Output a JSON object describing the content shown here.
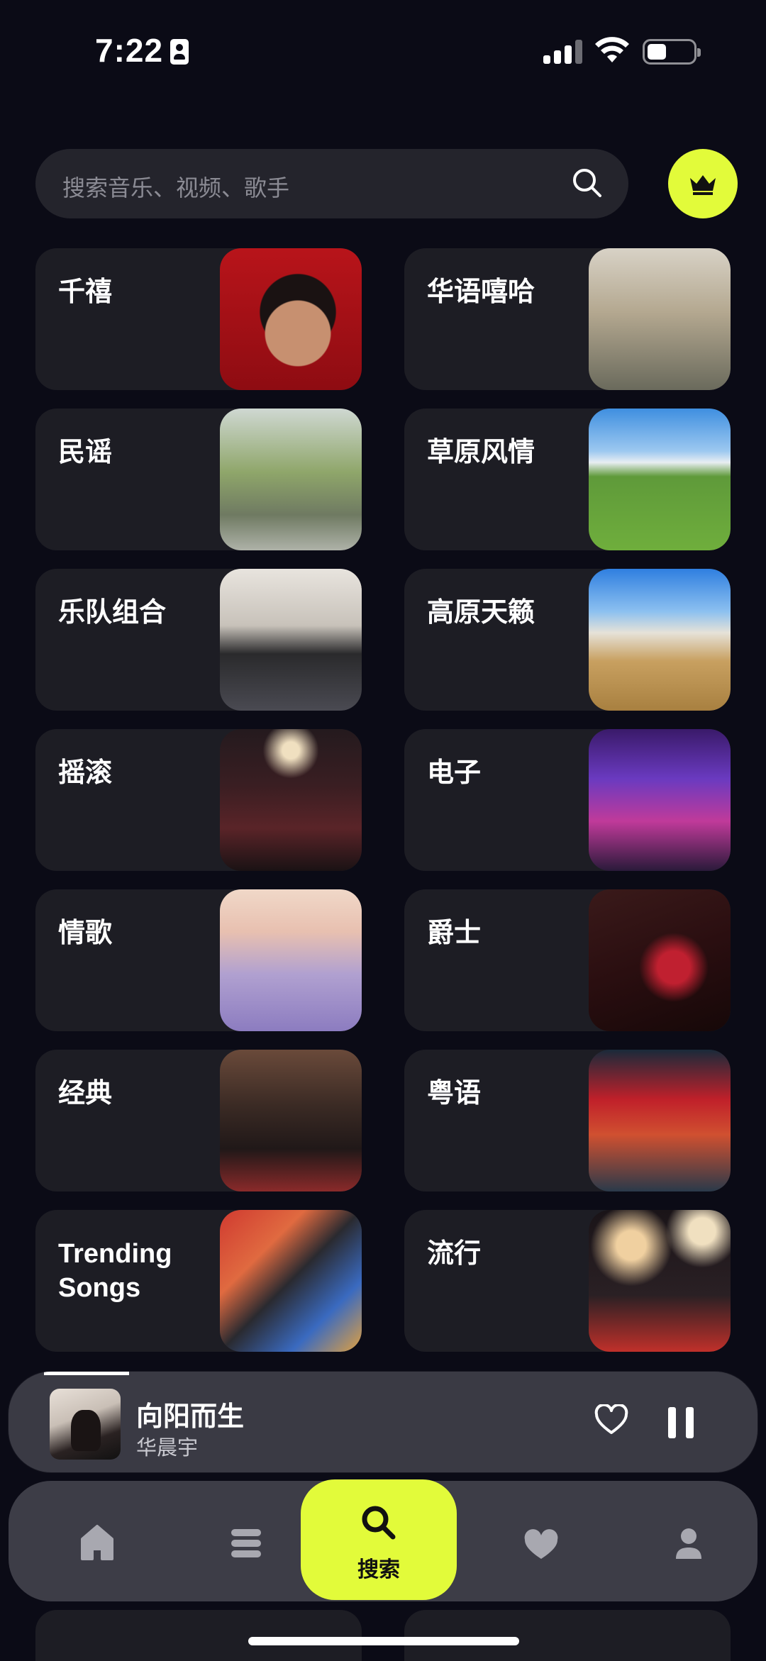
{
  "status_bar": {
    "time": "7:22"
  },
  "search": {
    "placeholder": "搜索音乐、视频、歌手"
  },
  "genres": [
    {
      "label": "千禧"
    },
    {
      "label": "华语嘻哈"
    },
    {
      "label": "民谣"
    },
    {
      "label": "草原风情"
    },
    {
      "label": "乐队组合"
    },
    {
      "label": "高原天籁"
    },
    {
      "label": "摇滚"
    },
    {
      "label": "电子"
    },
    {
      "label": "情歌"
    },
    {
      "label": "爵士"
    },
    {
      "label": "经典"
    },
    {
      "label": "粤语"
    },
    {
      "label": "Trending Songs"
    },
    {
      "label": "流行"
    }
  ],
  "now_playing": {
    "title": "向阳而生",
    "artist": "华晨宇"
  },
  "tab_bar": {
    "active_label": "搜索"
  },
  "colors": {
    "accent": "#e2fb3a",
    "background": "#0b0b16",
    "card": "#1d1d24"
  }
}
